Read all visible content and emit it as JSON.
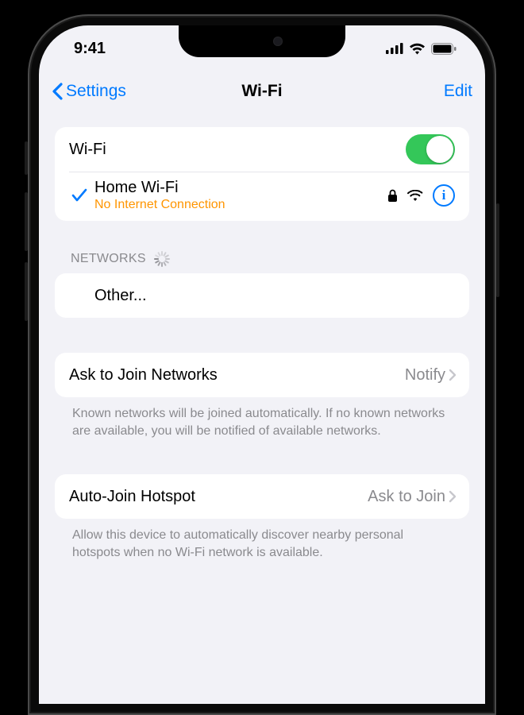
{
  "status": {
    "time": "9:41"
  },
  "nav": {
    "back_label": "Settings",
    "title": "Wi-Fi",
    "edit_label": "Edit"
  },
  "wifi": {
    "toggle_label": "Wi-Fi",
    "connected": {
      "name": "Home Wi-Fi",
      "subtext": "No Internet Connection"
    }
  },
  "networks": {
    "header": "NETWORKS",
    "other_label": "Other..."
  },
  "ask_join": {
    "label": "Ask to Join Networks",
    "value": "Notify",
    "footer": "Known networks will be joined automatically. If no known networks are available, you will be notified of available networks."
  },
  "auto_hotspot": {
    "label": "Auto-Join Hotspot",
    "value": "Ask to Join",
    "footer": "Allow this device to automatically discover nearby personal hotspots when no Wi-Fi network is available."
  }
}
